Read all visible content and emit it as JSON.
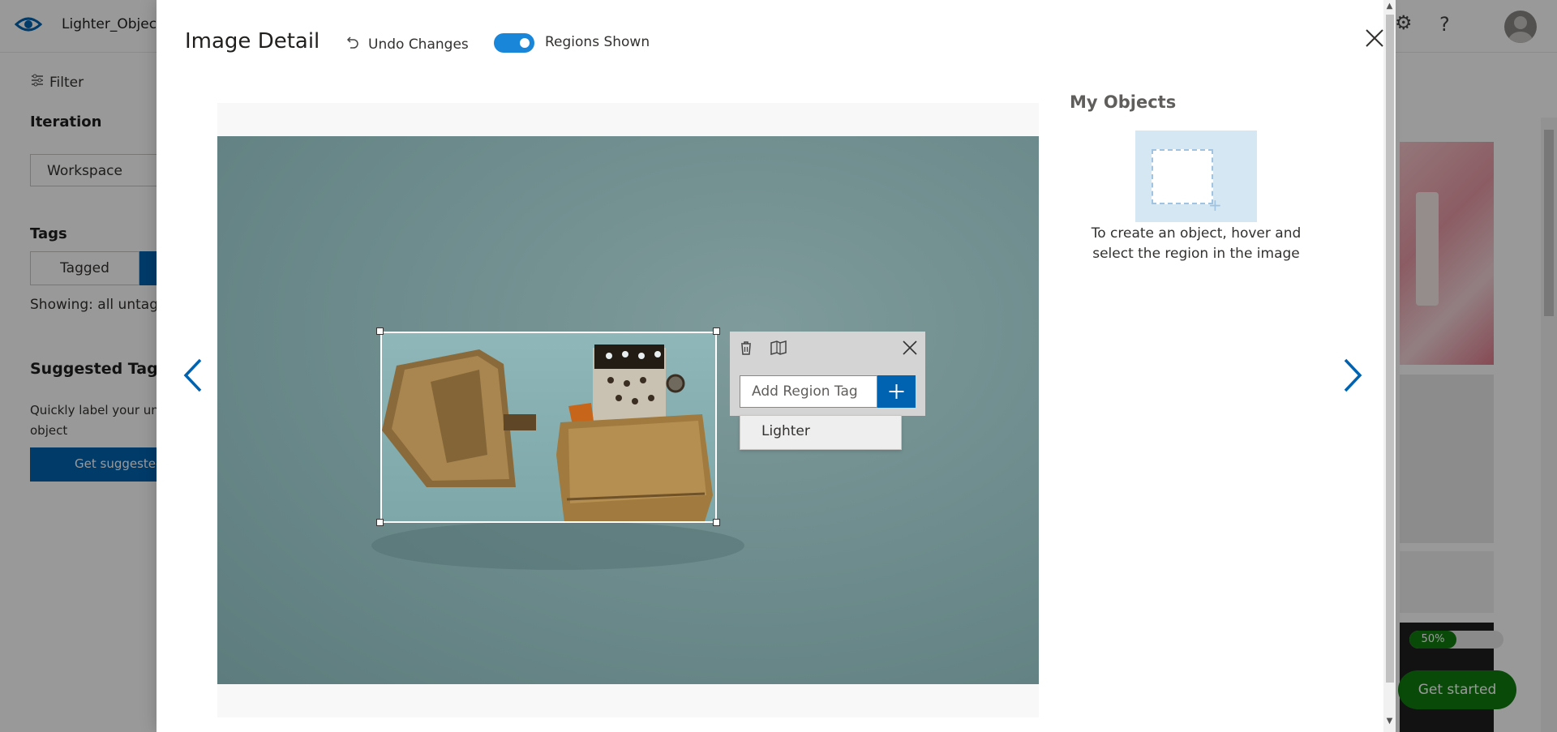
{
  "app": {
    "project_name": "Lighter_Object",
    "help_glyph": "?",
    "icons": [
      "eye-logo-icon",
      "help-icon",
      "avatar"
    ]
  },
  "sidebar": {
    "filter_label": "Filter",
    "iteration_title": "Iteration",
    "workspace_value": "Workspace",
    "tags_title": "Tags",
    "tagged_label": "Tagged",
    "showing_text": "Showing: all untagg",
    "suggested_title": "Suggested Tags",
    "suggested_desc": "Quickly label your unt with suggested object",
    "suggested_button": "Get suggested"
  },
  "background_right": {
    "progress_text": "50%",
    "progress_value": 50,
    "get_started_label": "Get started"
  },
  "modal": {
    "title": "Image Detail",
    "undo_label": "Undo Changes",
    "regions_toggle_label": "Regions Shown",
    "regions_toggle_on": true,
    "region_popup": {
      "input_placeholder": "Add Region Tag",
      "add_glyph": "+",
      "suggestions": [
        "Lighter"
      ]
    },
    "objects_panel": {
      "title": "My Objects",
      "hint": "To create an object, hover and select the region in the image"
    }
  },
  "colors": {
    "accent_blue": "#0063b1",
    "toggle_blue": "#1a86d9",
    "success_green": "#107c10"
  }
}
